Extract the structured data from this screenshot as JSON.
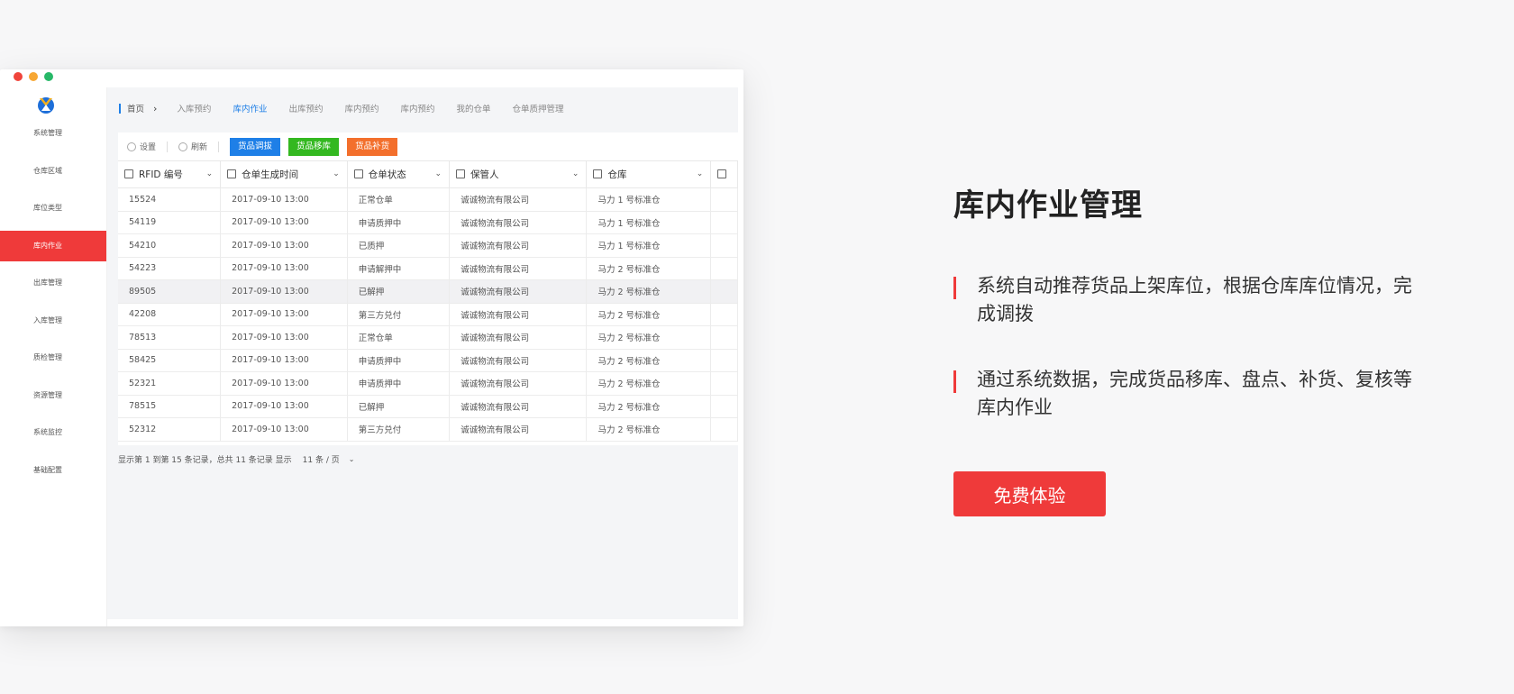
{
  "window": {
    "breadcrumb_home": "首页",
    "nav_tabs": [
      "入库预约",
      "库内作业",
      "出库预约",
      "库内预约",
      "库内预约",
      "我的仓单",
      "仓单质押管理"
    ],
    "active_tab": "库内作业"
  },
  "sidebar": {
    "items": [
      "系统管理",
      "仓库区域",
      "库位类型",
      "库内作业",
      "出库管理",
      "入库管理",
      "质检管理",
      "资源管理",
      "系统监控",
      "基础配置"
    ],
    "active": "库内作业"
  },
  "toolbar": {
    "settings": "设置",
    "refresh": "刷新",
    "btn_transfer": "货品调拔",
    "btn_move": "货品移库",
    "btn_replenish": "货品补货"
  },
  "table": {
    "headers": [
      "RFID 编号",
      "仓单生成时间",
      "仓单状态",
      "保管人",
      "仓库"
    ],
    "rows": [
      [
        "15524",
        "2017-09-10 13:00",
        "正常仓单",
        "诚诚物流有限公司",
        "马力 1 号标准仓"
      ],
      [
        "54119",
        "2017-09-10 13:00",
        "申请质押中",
        "诚诚物流有限公司",
        "马力 1 号标准仓"
      ],
      [
        "54210",
        "2017-09-10 13:00",
        "已质押",
        "诚诚物流有限公司",
        "马力 1 号标准仓"
      ],
      [
        "54223",
        "2017-09-10 13:00",
        "申请解押中",
        "诚诚物流有限公司",
        "马力 2 号标准仓"
      ],
      [
        "89505",
        "2017-09-10 13:00",
        "已解押",
        "诚诚物流有限公司",
        "马力 2 号标准仓"
      ],
      [
        "42208",
        "2017-09-10 13:00",
        "第三方兑付",
        "诚诚物流有限公司",
        "马力 2 号标准仓"
      ],
      [
        "78513",
        "2017-09-10 13:00",
        "正常仓单",
        "诚诚物流有限公司",
        "马力 2 号标准仓"
      ],
      [
        "58425",
        "2017-09-10 13:00",
        "申请质押中",
        "诚诚物流有限公司",
        "马力 2 号标准仓"
      ],
      [
        "52321",
        "2017-09-10 13:00",
        "申请质押中",
        "诚诚物流有限公司",
        "马力 2 号标准仓"
      ],
      [
        "78515",
        "2017-09-10 13:00",
        "已解押",
        "诚诚物流有限公司",
        "马力 2 号标准仓"
      ],
      [
        "52312",
        "2017-09-10 13:00",
        "第三方兑付",
        "诚诚物流有限公司",
        "马力 2 号标准仓"
      ]
    ],
    "highlight_row": 4
  },
  "pager": {
    "summary": "显示第 1 到第 15 条记录，总共 11 条记录  显示",
    "page_size": "11 条 / 页"
  },
  "promo": {
    "title": "库内作业管理",
    "point1": "系统自动推荐货品上架库位，根据仓库库位情况，完成调拨",
    "point2": "通过系统数据，完成货品移库、盘点、补货、复核等库内作业",
    "cta": "免费体验"
  },
  "colors": {
    "accent_red": "#ef3a3a",
    "link_blue": "#1e7fe7",
    "green": "#33b820",
    "orange": "#f36f2c"
  }
}
